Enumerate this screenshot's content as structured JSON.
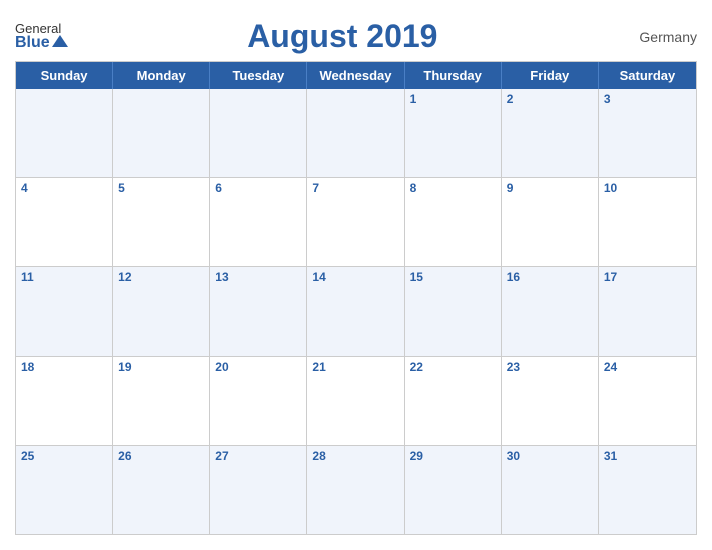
{
  "header": {
    "logo_general": "General",
    "logo_blue": "Blue",
    "title": "August 2019",
    "country": "Germany"
  },
  "day_headers": [
    "Sunday",
    "Monday",
    "Tuesday",
    "Wednesday",
    "Thursday",
    "Friday",
    "Saturday"
  ],
  "weeks": [
    [
      null,
      null,
      null,
      null,
      1,
      2,
      3
    ],
    [
      4,
      5,
      6,
      7,
      8,
      9,
      10
    ],
    [
      11,
      12,
      13,
      14,
      15,
      16,
      17
    ],
    [
      18,
      19,
      20,
      21,
      22,
      23,
      24
    ],
    [
      25,
      26,
      27,
      28,
      29,
      30,
      31
    ]
  ]
}
